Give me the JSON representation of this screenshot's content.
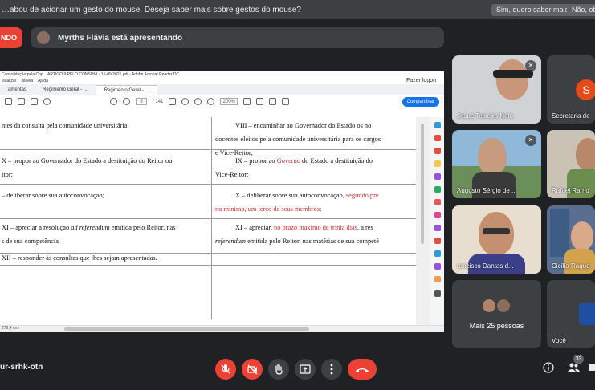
{
  "notification": {
    "text": "…abou de acionar um gesto do mouse. Deseja saber mais sobre gestos do mouse?",
    "accept": "Sim, quero saber mais",
    "decline": "Não, obri"
  },
  "presenting": {
    "stop_label": "NDO",
    "presenter_text": "Myrths Flávia está apresentando"
  },
  "pdf": {
    "window_title": "Consolidação pela Cop... ARTIGO 9 PELO CONSUNI - 15-09-2021.pdf - Adobe Acrobat Reader DC",
    "menu": [
      "isualizar",
      "Janela",
      "Ajuda"
    ],
    "logon": "Fazer logon",
    "tabs": [
      "amentas",
      "Regimento Geral - ...",
      "Regimento Geral - ..."
    ],
    "page_current": "8",
    "page_total": "/ 141",
    "zoom": "200%",
    "share": "Compartilhar",
    "page_size": "279,4 mm",
    "left_column": [
      "ntes da consulta pela comunidade universitária;",
      "X – propor ao Governador do Estado a destituição do Reitor ou",
      "itor;",
      "– deliberar sobre sua autoconvocação;",
      "XI – apreciar a resolução ",
      "ad referendum",
      " emitida pelo Reitor, nas",
      "s de sua competência",
      "XII – responder às consultas que lhes sejam apresentadas."
    ],
    "right_column": {
      "viii_a": "VIII – encaminhar ao Governador do Estado os no",
      "viii_b": "docentes eleitos pela comunidade universitária para os cargos",
      "viii_c": "e Vice-Reitor;",
      "ix_a": "IX – propor ao ",
      "ix_red": "Governo",
      "ix_b": " do Estado a destituição do",
      "ix_c": "Vice-Reitor;",
      "x_a": "X – deliberar sobre sua autoconvocação, ",
      "x_red": "segundo pre",
      "x_c": "no mínimo, um terço de seus membros;",
      "xi_a": "XI – apreciar, ",
      "xi_red": "no prazo máximo de trinta dias",
      "xi_b": ", a res",
      "xi_c_em": "referendum",
      "xi_c": " emitida pelo Reitor, nas matérias de sua competê"
    }
  },
  "participants": [
    {
      "name": "Josué Teixeira Neto"
    },
    {
      "name": "Secretaria de",
      "initial": "S"
    },
    {
      "name": "Augusto Sérgio de ..."
    },
    {
      "name": "Rafael Ramo"
    },
    {
      "name": "rancisco Dantas d..."
    },
    {
      "name": "Cicília Raque"
    },
    {
      "name": "Mais 25 pessoas"
    },
    {
      "name": "Você"
    }
  ],
  "meeting": {
    "code": "ur-srhk-otn",
    "participants_count": "33"
  },
  "colors": {
    "background": "#202124",
    "danger": "#ea4335",
    "control": "#3c4043",
    "accent": "#1473e6"
  }
}
